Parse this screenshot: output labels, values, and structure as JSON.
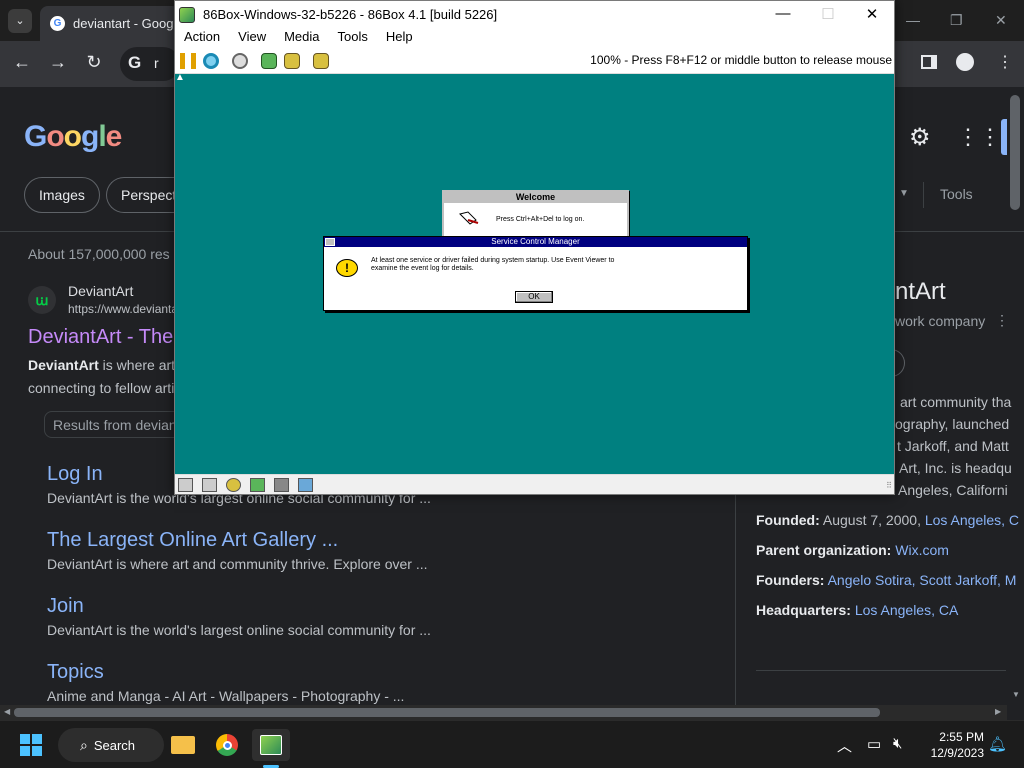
{
  "browser": {
    "tab_title": "deviantart - Google",
    "omnibox_text": "r",
    "serp": {
      "logo": "Google",
      "chips": [
        "Images",
        "Perspect"
      ],
      "tools_label": "Tools",
      "result_stats": "About 157,000,000 res",
      "result": {
        "site_name": "DeviantArt",
        "site_url": "https://www.devianta",
        "title": "DeviantArt - The",
        "snippet_line1_bold": "DeviantArt",
        "snippet_line1": " is where art",
        "snippet_line2": "connecting to fellow arti",
        "results_from": "Results from devianta"
      },
      "sitelinks": [
        {
          "title": "Log In",
          "desc": "DeviantArt is the world's largest online social community for ..."
        },
        {
          "title": "The Largest Online Art Gallery ...",
          "desc": "DeviantArt is where art and community thrive. Explore over ..."
        },
        {
          "title": "Join",
          "desc": "DeviantArt is the world's largest online social community for ..."
        },
        {
          "title": "Topics",
          "desc": "Anime and Manga - AI Art - Wallpapers - Photography - ..."
        }
      ],
      "knowledge_panel": {
        "title": "ntArt",
        "subtitle": "work company",
        "lines": [
          "art community tha",
          "ography, launched",
          "t Jarkoff, and Matt",
          "Art, Inc. is headqu",
          "Angeles, Californi"
        ],
        "facts": [
          {
            "label": "Founded:",
            "value": "August 7, 2000,",
            "link": "Los Angeles, C"
          },
          {
            "label": "Parent organization:",
            "value": "",
            "link": "Wix.com"
          },
          {
            "label": "Founders:",
            "value": "",
            "link": "Angelo Sotira, Scott Jarkoff, M"
          },
          {
            "label": "Headquarters:",
            "value": "",
            "link": "Los Angeles, CA"
          }
        ]
      }
    }
  },
  "emulator": {
    "window_title": "86Box-Windows-32-b5226 - 86Box 4.1 [build 5226]",
    "menu": [
      "Action",
      "View",
      "Media",
      "Tools",
      "Help"
    ],
    "status_text": "100% - Press F8+F12 or middle button to release mouse",
    "guest": {
      "welcome_title": "Welcome",
      "welcome_message": "Press Ctrl+Alt+Del to log on.",
      "scm_title": "Service Control Manager",
      "scm_message_line1": "At least one service or driver failed during system startup.  Use Event Viewer to",
      "scm_message_line2": "examine the event log for details.",
      "ok_label": "OK"
    }
  },
  "taskbar": {
    "search_label": "Search",
    "time": "2:55 PM",
    "date": "12/9/2023"
  },
  "colors": {
    "guest_desktop": "#008080",
    "link_blue": "#8ab4f8",
    "visited_purple": "#c58af9"
  }
}
